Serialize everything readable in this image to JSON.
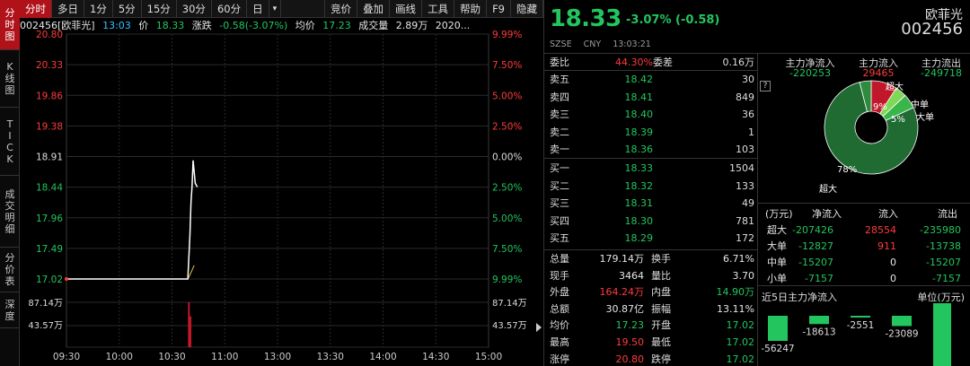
{
  "tabs_vertical": [
    {
      "label": [
        "分",
        "时",
        "图"
      ],
      "active": true
    },
    {
      "label": [
        "K",
        "线",
        "图"
      ],
      "active": false
    },
    {
      "label": [
        "T",
        "I",
        "C",
        "K"
      ],
      "active": false
    },
    {
      "label": [
        "成",
        "交",
        "明",
        "细"
      ],
      "active": false
    },
    {
      "label": [
        "分",
        "价",
        "表"
      ],
      "active": false
    },
    {
      "label": [
        "深",
        "度"
      ],
      "active": false
    }
  ],
  "toolbar": [
    "分时",
    "多日",
    "1分",
    "5分",
    "15分",
    "30分",
    "60分",
    "日",
    "▾",
    "",
    "竞价",
    "叠加",
    "画线",
    "工具",
    "帮助",
    "F9",
    "隐藏"
  ],
  "infoline": {
    "code_name": "002456[欧菲光]",
    "time": "13:03",
    "price_label": "价",
    "price": "18.33",
    "change_label": "涨跌",
    "change": "-0.58(-3.07%)",
    "avg_label": "均价",
    "avg": "17.23",
    "vol_label": "成交量",
    "vol": "2.89万",
    "date": "2020..."
  },
  "chart_data": {
    "type": "line",
    "x_ticks": [
      "09:30",
      "10:00",
      "10:30",
      "11:00",
      "13:00",
      "13:30",
      "14:00",
      "14:30",
      "15:00"
    ],
    "price_ticks_left": [
      "20.80",
      "20.33",
      "19.86",
      "19.38",
      "18.91",
      "18.44",
      "17.96",
      "17.49",
      "17.02"
    ],
    "pct_ticks_right": [
      "9.99%",
      "7.50%",
      "5.00%",
      "2.50%",
      "0.00%",
      "2.50%",
      "5.00%",
      "7.50%",
      "9.99%"
    ],
    "volume_ticks": [
      "87.14万",
      "43.57万"
    ],
    "ylim": [
      17.02,
      20.8
    ],
    "prev_close": 18.91,
    "price_series": [
      [
        0,
        17.02
      ],
      [
        2.2,
        17.02
      ],
      [
        2.3,
        17.02
      ],
      [
        2.34,
        17.7
      ],
      [
        2.36,
        18.2
      ],
      [
        2.38,
        18.45
      ],
      [
        2.4,
        18.85
      ],
      [
        2.44,
        18.5
      ],
      [
        2.48,
        18.44
      ]
    ],
    "avg_series": [
      [
        2.3,
        17.02
      ],
      [
        2.35,
        17.1
      ],
      [
        2.42,
        17.23
      ]
    ],
    "volume_bars": [
      [
        2.32,
        87.14
      ],
      [
        2.35,
        60
      ]
    ]
  },
  "quote": {
    "price": "18.33",
    "change": "-3.07% (-0.58)",
    "name": "欧菲光",
    "code": "002456",
    "exchange": "SZSE",
    "currency": "CNY",
    "time": "13:03:21"
  },
  "orderbook": {
    "ratio_label": "委比",
    "ratio": "44.30%",
    "diff_label": "委差",
    "diff": "0.16万",
    "asks": [
      {
        "label": "卖五",
        "price": "18.42",
        "vol": "30"
      },
      {
        "label": "卖四",
        "price": "18.41",
        "vol": "849"
      },
      {
        "label": "卖三",
        "price": "18.40",
        "vol": "36"
      },
      {
        "label": "卖二",
        "price": "18.39",
        "vol": "1"
      },
      {
        "label": "卖一",
        "price": "18.36",
        "vol": "103"
      }
    ],
    "bids": [
      {
        "label": "买一",
        "price": "18.33",
        "vol": "1504"
      },
      {
        "label": "买二",
        "price": "18.32",
        "vol": "133"
      },
      {
        "label": "买三",
        "price": "18.31",
        "vol": "49"
      },
      {
        "label": "买四",
        "price": "18.30",
        "vol": "781"
      },
      {
        "label": "买五",
        "price": "18.29",
        "vol": "172"
      }
    ]
  },
  "stats": [
    {
      "l1": "总量",
      "v1": "179.14万",
      "c1": "white",
      "l2": "换手",
      "v2": "6.71%",
      "c2": "white"
    },
    {
      "l1": "现手",
      "v1": "3464",
      "c1": "white",
      "l2": "量比",
      "v2": "3.70",
      "c2": "white"
    },
    {
      "l1": "外盘",
      "v1": "164.24万",
      "c1": "red",
      "l2": "内盘",
      "v2": "14.90万",
      "c2": "green"
    },
    {
      "l1": "总额",
      "v1": "30.87亿",
      "c1": "white",
      "l2": "振幅",
      "v2": "13.11%",
      "c2": "white"
    },
    {
      "l1": "均价",
      "v1": "17.23",
      "c1": "green",
      "l2": "开盘",
      "v2": "17.02",
      "c2": "green"
    },
    {
      "l1": "最高",
      "v1": "19.50",
      "c1": "red",
      "l2": "最低",
      "v2": "17.02",
      "c2": "green"
    },
    {
      "l1": "涨停",
      "v1": "20.80",
      "c1": "red",
      "l2": "跌停",
      "v2": "17.02",
      "c2": "green"
    }
  ],
  "flow": {
    "headers": [
      "主力净流入",
      "主力流入",
      "主力流出"
    ],
    "values": [
      "-220253",
      "29465",
      "-249718"
    ],
    "help": "?",
    "pie": {
      "slices": [
        {
          "name": "超大",
          "pct": 9,
          "color": "#c0182a"
        },
        {
          "name": "大单",
          "pct": 4,
          "color": "#7ed957"
        },
        {
          "name": "中单",
          "pct": 5,
          "color": "#39b54a"
        },
        {
          "name": "超大",
          "pct": 78,
          "color": "#1f6b32"
        },
        {
          "name": "other",
          "pct": 4,
          "color": "#2e8b3e"
        }
      ],
      "labels": [
        "9%",
        "5%",
        "78%"
      ],
      "legend": [
        "超大",
        "中单",
        "大单",
        "超大"
      ]
    },
    "table": {
      "headers": [
        "(万元)",
        "净流入",
        "流入",
        "流出"
      ],
      "rows": [
        {
          "k": "超大",
          "net": "-207426",
          "in": "28554",
          "out": "-235980",
          "inc": "red"
        },
        {
          "k": "大单",
          "net": "-12827",
          "in": "911",
          "out": "-13738",
          "inc": "red"
        },
        {
          "k": "中单",
          "net": "-15207",
          "in": "0",
          "out": "-15207",
          "inc": "white"
        },
        {
          "k": "小单",
          "net": "-7157",
          "in": "0",
          "out": "-7157",
          "inc": "white"
        }
      ]
    },
    "five_day_title": "近5日主力净流入",
    "five_day_unit": "单位(万元)",
    "five_day": [
      {
        "v": -56247,
        "label": "-56247"
      },
      {
        "v": -18613,
        "label": "-18613"
      },
      {
        "v": -2551,
        "label": "-2551"
      },
      {
        "v": -23089,
        "label": "-23089"
      },
      {
        "v": -220253,
        "label": ""
      }
    ]
  },
  "colors": {
    "up": "#ff3b3b",
    "down": "#22c55e",
    "accent": "#b0121a",
    "avg_line": "#e6c84a"
  }
}
